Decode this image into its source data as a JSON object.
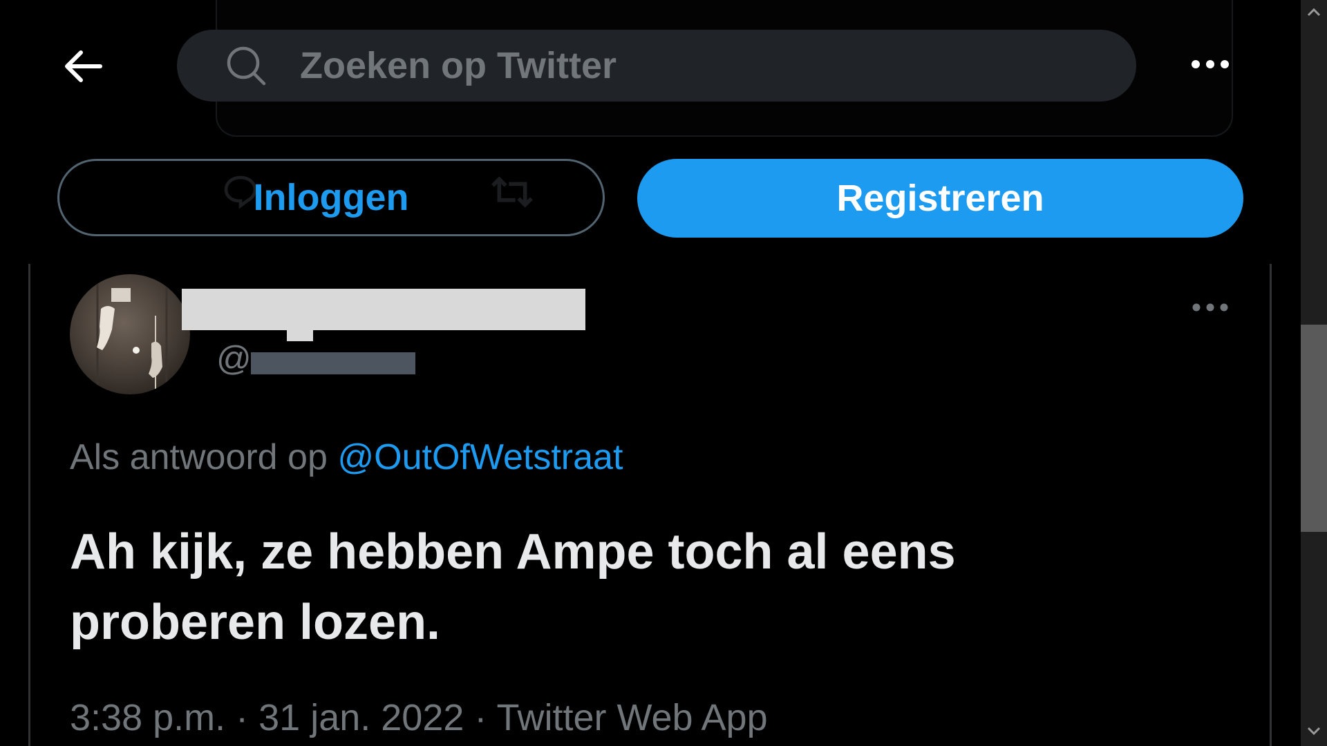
{
  "header": {
    "search_placeholder": "Zoeken op Twitter"
  },
  "buttons": {
    "login_label": "Inloggen",
    "register_label": "Registreren"
  },
  "tweet": {
    "at_prefix": "@",
    "reply_prefix": "Als antwoord op",
    "reply_handle": "@OutOfWetstraat",
    "text": "Ah kijk, ze hebben Ampe toch al eens proberen lozen.",
    "time": "3:38 p.m.",
    "separator": "·",
    "date": "31 jan. 2022",
    "source": "Twitter Web App"
  },
  "icons": {
    "back": "arrow-left-icon",
    "search": "search-icon",
    "more": "more-horizontal-icon"
  },
  "colors": {
    "accent": "#1d9bf0",
    "background": "#000000",
    "secondary_text": "#71767b",
    "primary_text": "#e7e9ea"
  }
}
